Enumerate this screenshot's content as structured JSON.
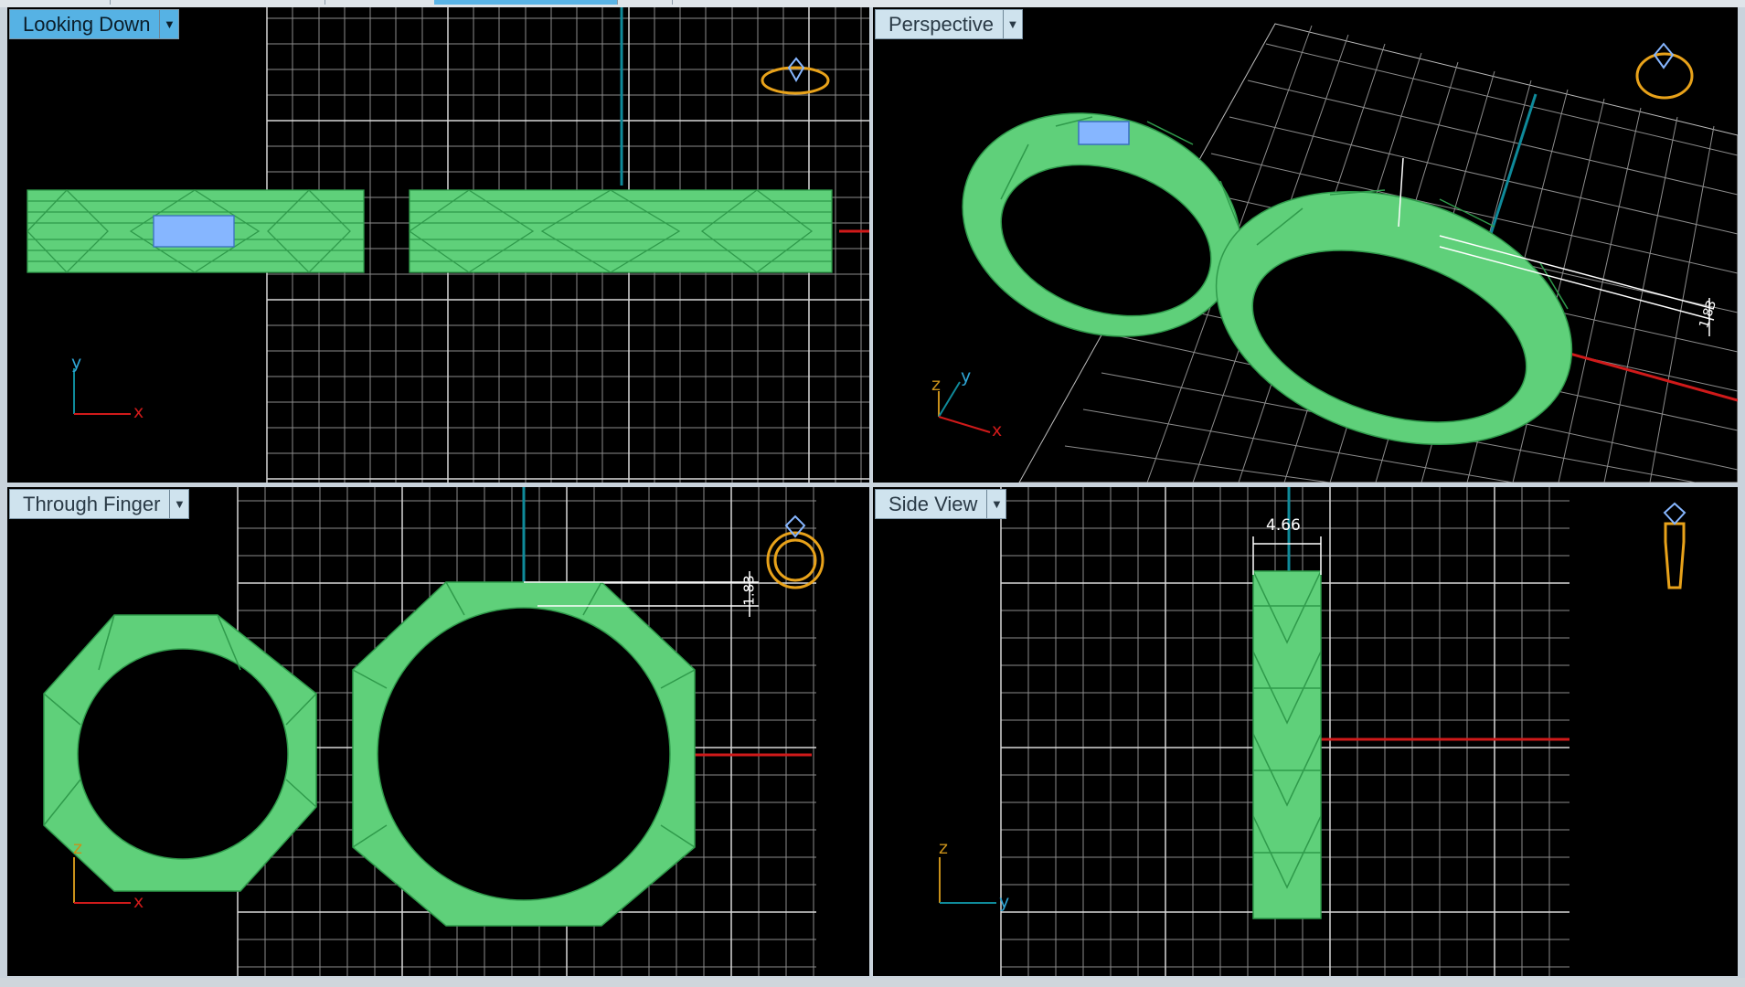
{
  "viewports": {
    "top": {
      "label": "Looking Down",
      "axes": {
        "horizontal": "x",
        "vertical": "y"
      }
    },
    "persp": {
      "label": "Perspective",
      "axes": {
        "a": "z",
        "b": "y",
        "c": "x"
      },
      "dimension": "1.83"
    },
    "front": {
      "label": "Through Finger",
      "axes": {
        "horizontal": "x",
        "vertical": "z"
      },
      "dimension": "1.83"
    },
    "side": {
      "label": "Side View",
      "axes": {
        "horizontal": "y",
        "vertical": "z"
      },
      "dimension": "4.66"
    }
  },
  "icons": {
    "dropdown": "chevron-down-icon",
    "orientation": "ring-orientation-icon"
  },
  "colors": {
    "grid": "#8c8c8c",
    "mesh": "#5fd07a",
    "mesh_line": "#2f9a4b",
    "stone": "#86b6ff",
    "x_axis": "#d01a1a",
    "y_axis": "#0f8a9a",
    "z_axis": "#c8901a",
    "label_active": "#56b2e4",
    "label": "#cfe3ee",
    "orientation_icon": "#e8a21a"
  }
}
